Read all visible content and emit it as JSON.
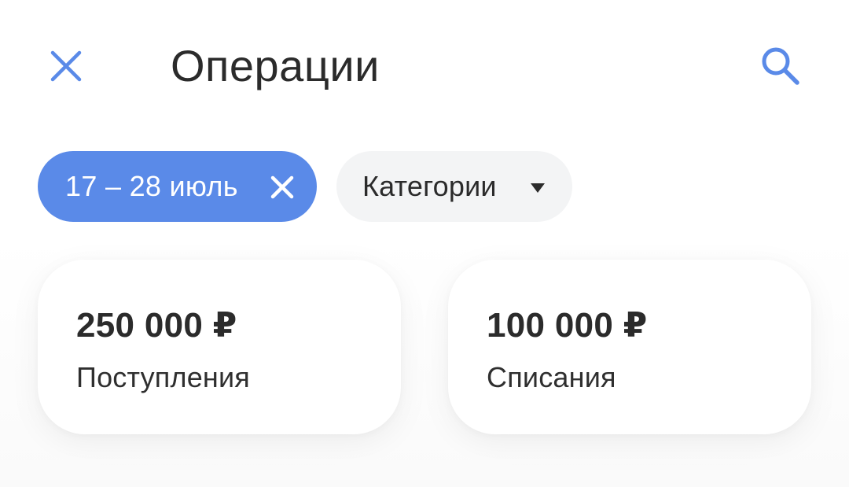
{
  "colors": {
    "accent": "#5a8ae8",
    "text_primary": "#2b2b2b",
    "chip_background": "#f3f4f5",
    "card_background": "#ffffff"
  },
  "header": {
    "title": "Операции",
    "close_icon": "close-icon",
    "search_icon": "search-icon"
  },
  "filters": {
    "date_range": {
      "label": "17 – 28 июль",
      "clear_icon": "close-icon"
    },
    "category": {
      "label": "Категории",
      "dropdown_icon": "caret-down-icon"
    }
  },
  "summary": {
    "income": {
      "amount": "250 000 ₽",
      "label": "Поступления"
    },
    "expense": {
      "amount": "100 000 ₽",
      "label": "Списания"
    }
  }
}
